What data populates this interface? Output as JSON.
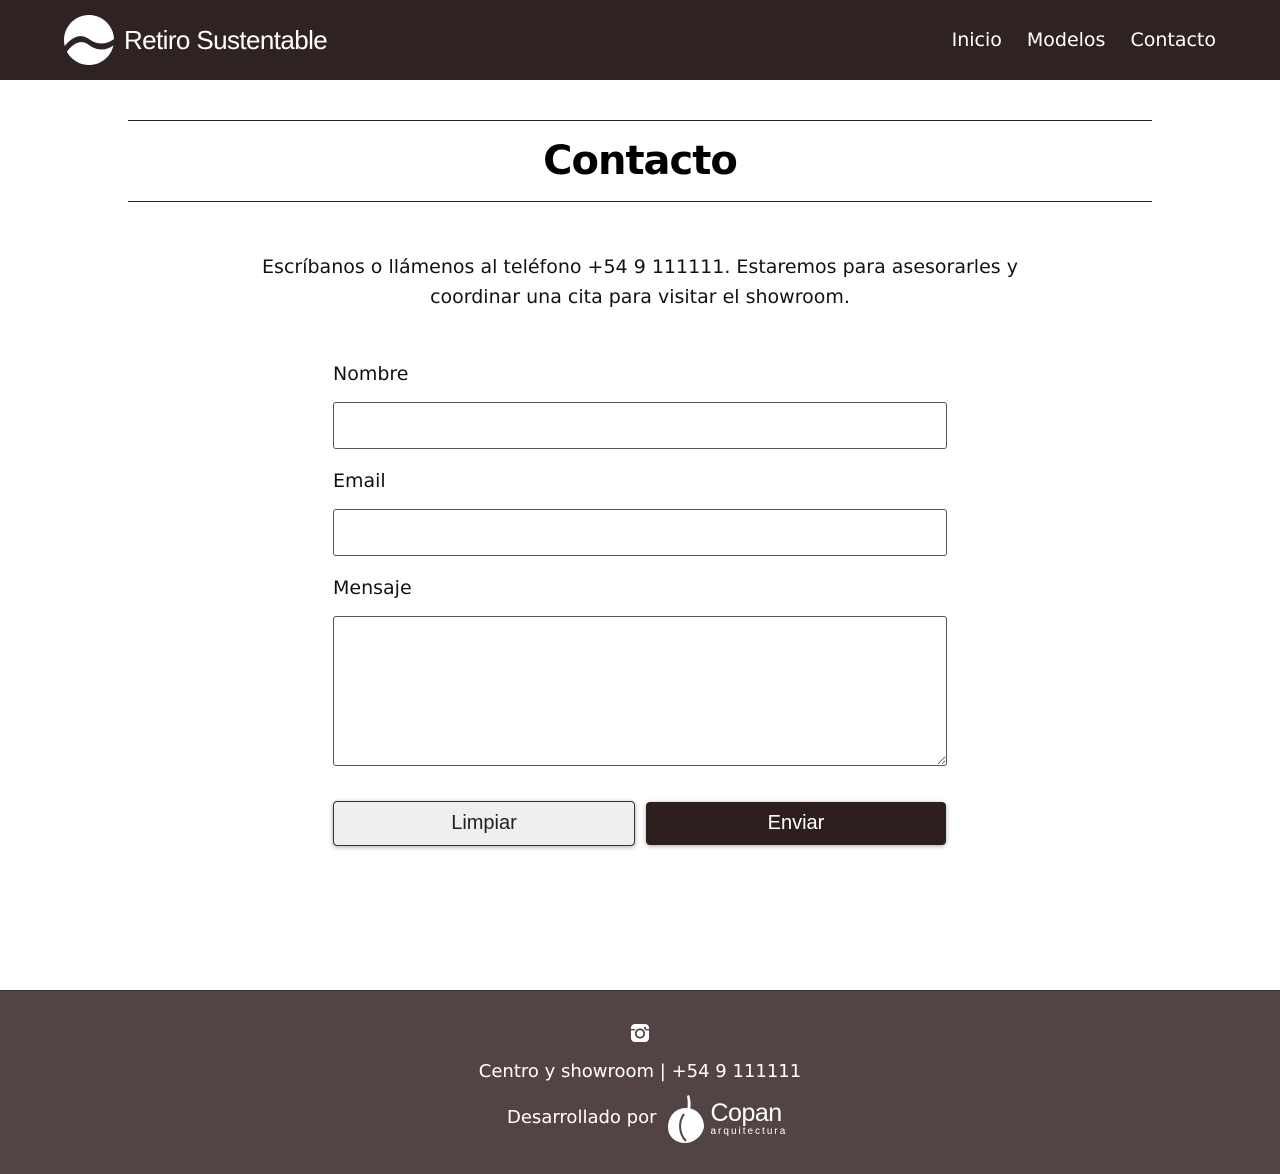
{
  "header": {
    "brand_name": "Retiro Sustentable",
    "nav": [
      "Inicio",
      "Modelos",
      "Contacto"
    ]
  },
  "main": {
    "title": "Contacto",
    "intro": "Escríbanos o llámenos al teléfono +54 9 111111. Estaremos para asesorarles y coordinar una cita para visitar el showroom.",
    "form": {
      "name_label": "Nombre",
      "name_value": "",
      "email_label": "Email",
      "email_value": "",
      "message_label": "Mensaje",
      "message_value": "",
      "clear_label": "Limpiar",
      "send_label": "Enviar"
    }
  },
  "footer": {
    "social_icon": "instagram-icon",
    "contact_line": "Centro y showroom | +54 9 111111",
    "credit_prefix": "Desarrollado por",
    "credit_name": "Copan",
    "credit_sub": "arquitectura"
  },
  "colors": {
    "header_bg": "#2e2222",
    "footer_bg": "#524444",
    "send_button_bg": "#2e1f1f",
    "clear_button_bg": "#efefef"
  }
}
